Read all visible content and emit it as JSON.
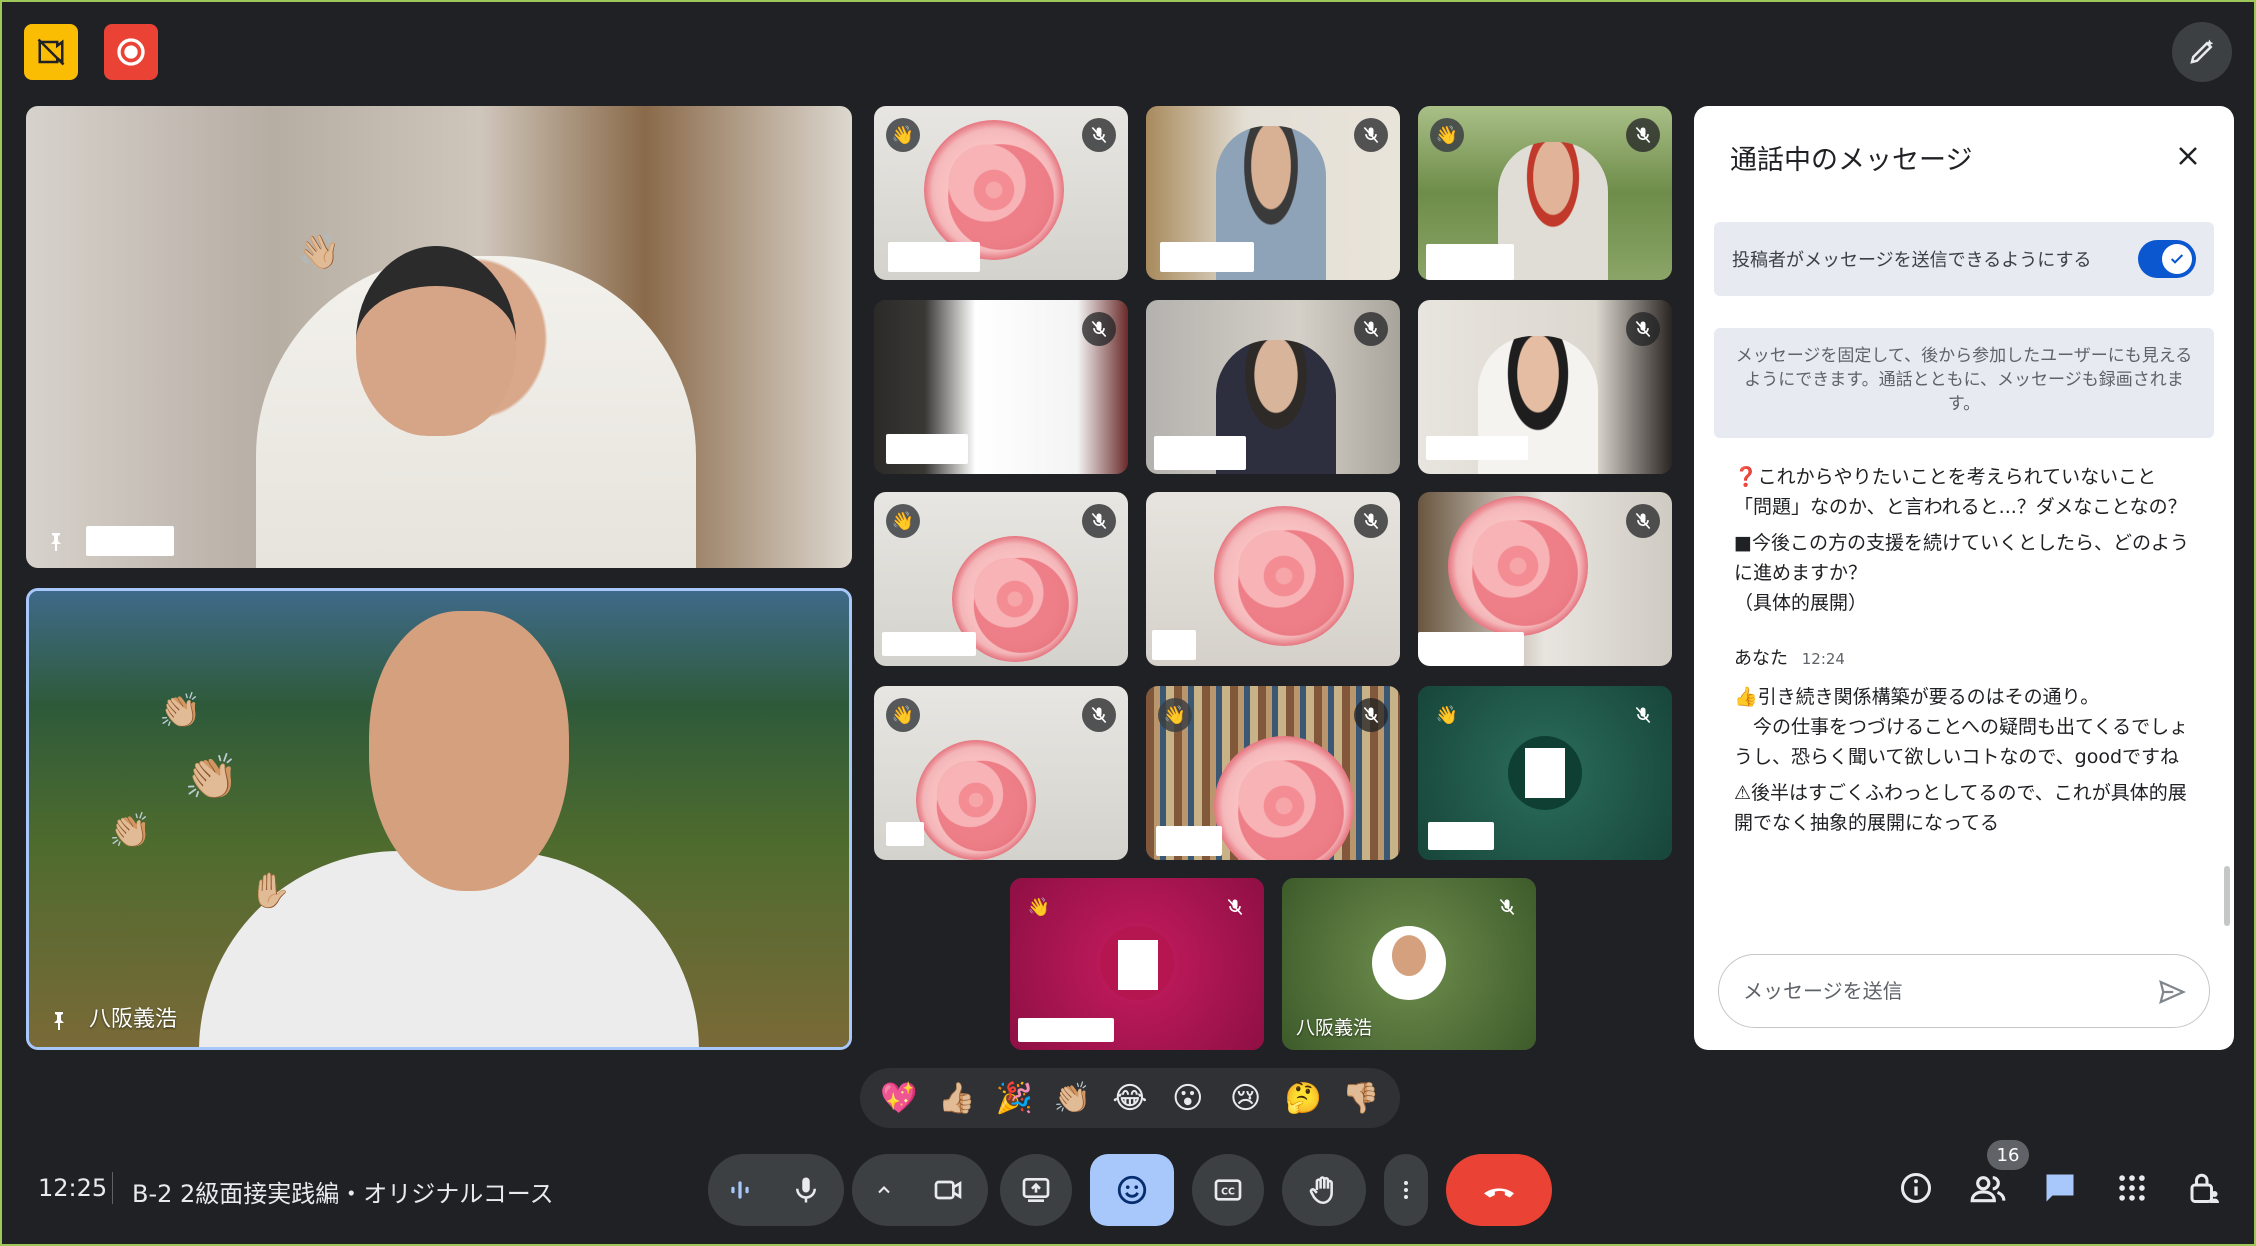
{
  "toolbar_top": {
    "left_buttons": [
      "no-video-icon",
      "record-icon"
    ],
    "right_button": "edit-pen-icon"
  },
  "tiles": {
    "main_top": {
      "name": "",
      "icon": "pin-icon"
    },
    "main_bottom": {
      "name": "八阪義浩",
      "icon": "pin-icon"
    },
    "bottom_right_avatar_name": "八阪義浩"
  },
  "chat": {
    "title": "通話中のメッセージ",
    "toggle_label": "投稿者がメッセージを送信できるようにする",
    "toggle_on": true,
    "info_text": "メッセージを固定して、後から参加したユーザーにも見えるようにできます。通話とともに、メッセージも録画されます。",
    "messages_before": [
      "❓これからやりたいことを考えられていないこと「問題」なのか、と言われると...？ダメなことなの？",
      "■今後この方の支援を続けていくとしたら、どのように進めますか？\n（具体的展開）"
    ],
    "sender": "あなた",
    "sender_time": "12:24",
    "messages_after": [
      "👍引き続き関係構築が要るのはその通り。\n　今の仕事をつづけることへの疑問も出てくるでしょうし、恐らく聞いて欲しいコトなので、goodですね",
      "⚠後半はすごくふわっとしてるので、これが具体的展開でなく抽象的展開になってる"
    ],
    "input_placeholder": "メッセージを送信"
  },
  "reactions": [
    "💖",
    "👍🏼",
    "🎉",
    "👏🏼",
    "😂",
    "😮",
    "😢",
    "🤔",
    "👎🏼"
  ],
  "bottom_bar": {
    "time": "12:25",
    "title": "B-2 2級面接実践編・オリジナルコース",
    "participant_count": "16"
  },
  "colors": {
    "background": "#202124",
    "accent_blue": "#0b57d0",
    "end_call_red": "#ea4335",
    "reaction_active": "#a8c7fa"
  }
}
